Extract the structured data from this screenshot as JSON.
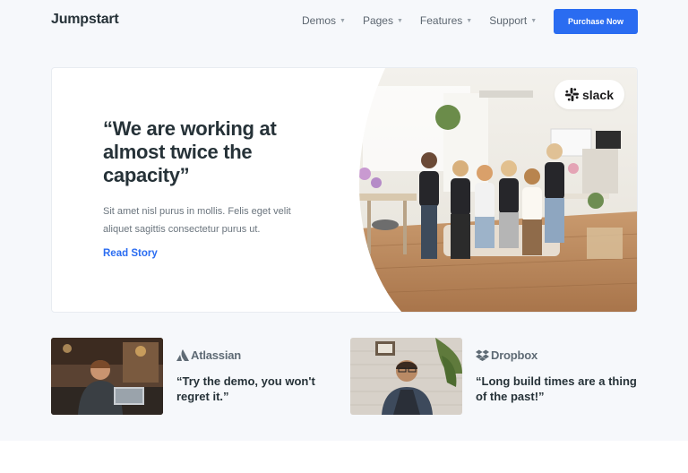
{
  "nav": {
    "brand": "Jumpstart",
    "menu": [
      {
        "label": "Demos"
      },
      {
        "label": "Pages"
      },
      {
        "label": "Features"
      },
      {
        "label": "Support"
      }
    ],
    "cta_label": "Purchase Now"
  },
  "hero": {
    "quote": "“We are working at almost twice the capacity”",
    "body": "Sit amet nisl purus in mollis. Felis eget velit aliquet sagittis consectetur purus ut.",
    "link_label": "Read Story",
    "logo_text": "slack"
  },
  "cards": [
    {
      "logo_text": "Atlassian",
      "logo_icon": "atlassian-icon",
      "quote": "“Try the demo, you won't regret it.”"
    },
    {
      "logo_text": "Dropbox",
      "logo_icon": "dropbox-icon",
      "quote": "“Long build times are a thing of the past!”"
    }
  ],
  "colors": {
    "accent": "#2a6cf1",
    "background": "#f6f8fb",
    "heading": "#263238",
    "muted": "#6b757e"
  }
}
